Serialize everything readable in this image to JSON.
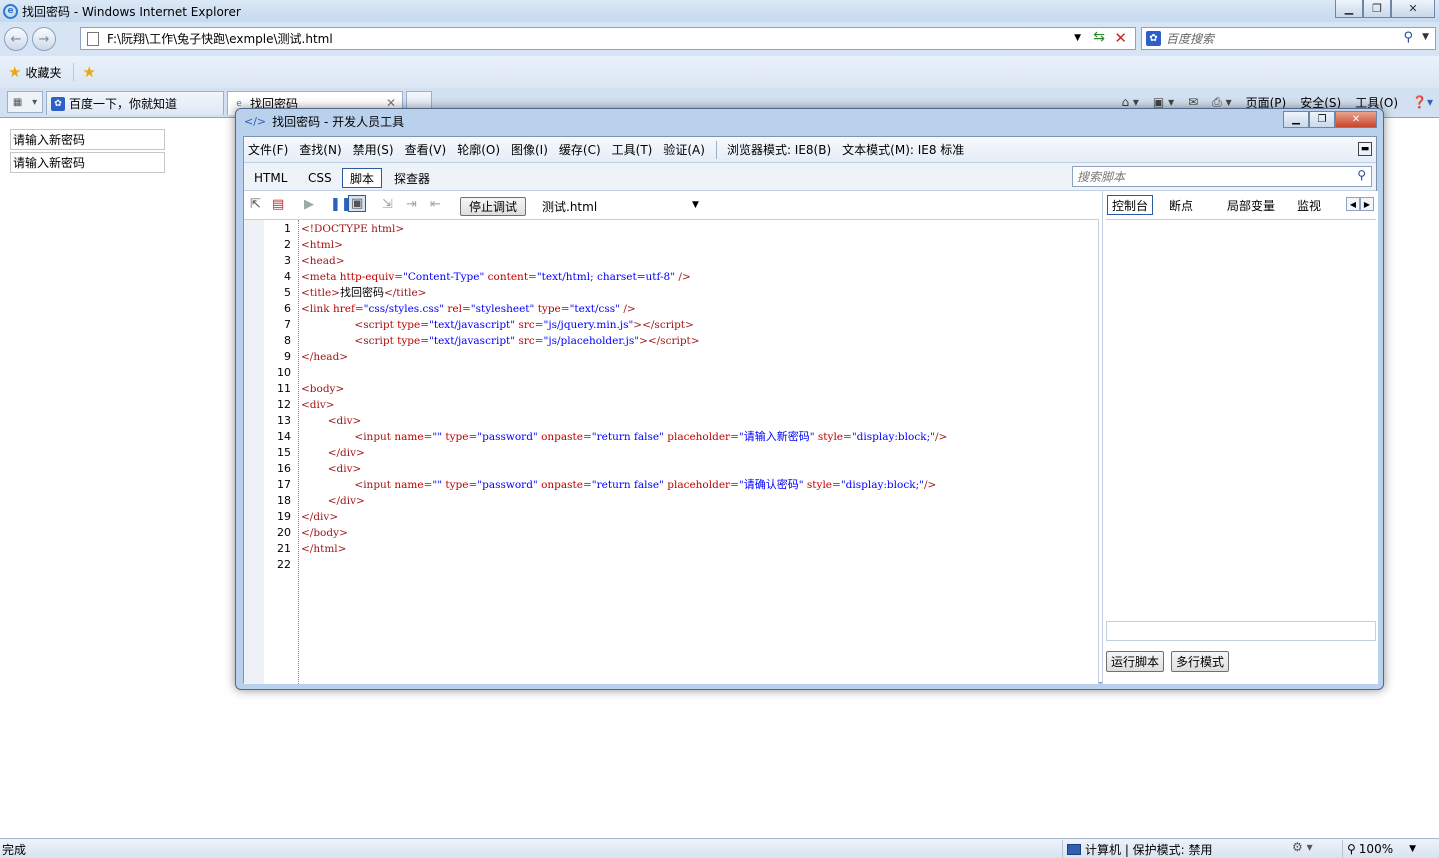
{
  "window": {
    "title": "找回密码 - Windows Internet Explorer",
    "address": "F:\\阮翔\\工作\\兔子快跑\\exmple\\测试.html",
    "search_placeholder": "百度搜索"
  },
  "favorites": {
    "label": "收藏夹"
  },
  "tabs": [
    {
      "label": "百度一下，你就知道",
      "active": false
    },
    {
      "label": "找回密码",
      "active": true
    }
  ],
  "command_bar": {
    "page": "页面(P)",
    "safety": "安全(S)",
    "tools": "工具(O)"
  },
  "page": {
    "inputs": [
      {
        "placeholder": "请输入新密码"
      },
      {
        "placeholder": "请输入新密码"
      }
    ]
  },
  "status_bar": {
    "left": "完成",
    "zone": "计算机 | 保护模式: 禁用",
    "zoom": "100%"
  },
  "devtools": {
    "title": "找回密码 - 开发人员工具",
    "menu": [
      "文件(F)",
      "查找(N)",
      "禁用(S)",
      "查看(V)",
      "轮廓(O)",
      "图像(I)",
      "缓存(C)",
      "工具(T)",
      "验证(A)"
    ],
    "browser_mode": "浏览器模式: IE8(B)",
    "document_mode": "文本模式(M): IE8 标准",
    "tabs": [
      "HTML",
      "CSS",
      "脚本",
      "探查器"
    ],
    "active_tab": "脚本",
    "search_placeholder": "搜索脚本",
    "stop_debug": "停止调试",
    "file": "测试.html",
    "right_tabs": [
      "控制台",
      "断点",
      "局部变量",
      "监视"
    ],
    "run_script": "运行脚本",
    "multiline": "多行模式",
    "line_numbers": [
      "1",
      "2",
      "3",
      "4",
      "5",
      "6",
      "7",
      "8",
      "9",
      "10",
      "11",
      "12",
      "13",
      "14",
      "15",
      "16",
      "17",
      "18",
      "19",
      "20",
      "21",
      "22"
    ]
  }
}
